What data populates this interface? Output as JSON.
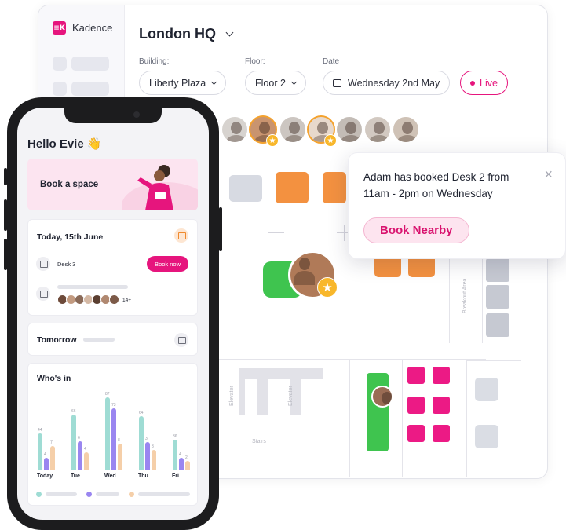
{
  "colors": {
    "brand": "#e6157d",
    "orange": "#f08a2c",
    "green": "#3fc44f",
    "grey_desk": "#c9ccd6",
    "teal": "#9fdcd4",
    "purple": "#9a86f0",
    "peach": "#f5cfa9"
  },
  "app": {
    "name": "Kadence",
    "logo_text": "≡K"
  },
  "header": {
    "title": "London HQ"
  },
  "filters": {
    "building_label": "Building:",
    "building_value": "Liberty Plaza",
    "floor_label": "Floor:",
    "floor_value": "Floor 2",
    "date_label": "Date",
    "date_value": "Wednesday 2nd May",
    "live_label": "Live"
  },
  "floorplan": {
    "label_elevator": "Elevator",
    "label_stairs": "Stairs",
    "label_breakout": "Breakout Area"
  },
  "notification": {
    "message": "Adam has booked Desk 2 from 11am - 2pm on Wednesday",
    "close": "×",
    "button": "Book Nearby"
  },
  "mobile": {
    "greeting": "Hello Evie 👋",
    "banner": "Book a space",
    "today_title": "Today, 15th June",
    "desk_label": "Desk 3",
    "book_now": "Book now",
    "attendee_count": "14+",
    "tomorrow_title": "Tomorrow",
    "whos_in_title": "Who's in",
    "chart": {
      "days": [
        "Today",
        "Tue",
        "Wed",
        "Thu",
        "Fri"
      ],
      "series": [
        {
          "values": [
            44,
            66,
            87,
            64,
            36
          ]
        },
        {
          "values": [
            14,
            34,
            74,
            33,
            14
          ]
        },
        {
          "values": [
            28,
            21,
            31,
            24,
            10
          ]
        }
      ],
      "labels": [
        [
          "44",
          "4",
          "7"
        ],
        [
          "66",
          "6",
          "4"
        ],
        [
          "87",
          "73",
          "8"
        ],
        [
          "64",
          "3",
          "3"
        ],
        [
          "36",
          "4",
          "2"
        ]
      ]
    }
  }
}
